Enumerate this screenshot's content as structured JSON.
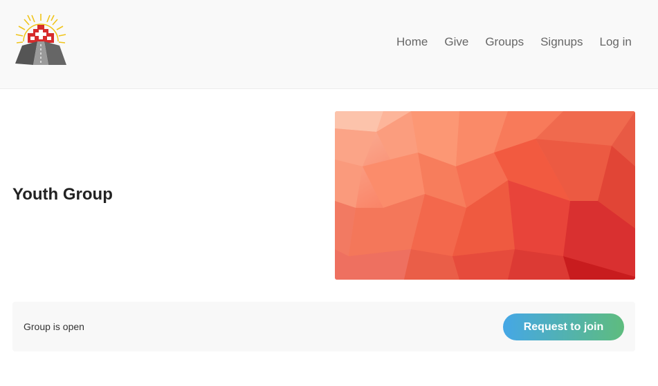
{
  "header": {
    "logo_icon": "church-cross-mountain-logo",
    "nav": [
      {
        "label": "Home"
      },
      {
        "label": "Give"
      },
      {
        "label": "Groups"
      },
      {
        "label": "Signups"
      },
      {
        "label": "Log in"
      }
    ]
  },
  "main": {
    "title": "Youth Group",
    "banner_colors": [
      "#fbb9a0",
      "#f9785a",
      "#f14a34",
      "#c81c1e"
    ]
  },
  "status": {
    "text": "Group is open",
    "button_label": "Request to join",
    "button_gradient": [
      "#45a7e6",
      "#5ebc7e"
    ]
  }
}
